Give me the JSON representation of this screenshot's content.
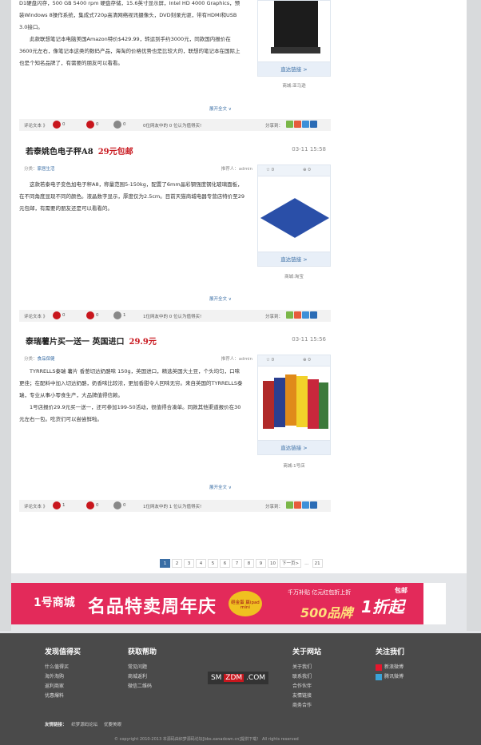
{
  "article0": {
    "body_lines": [
      "D1硬盘闪存，500 GB 5400 rpm 硬盘存储，15.6英寸显示屏，Intel HD 4000 Graphics，预装Windows 8操作系统，集成式720p高清网络视讯摄像头，DVD刻录光驱，带有HDMI和USB 3.0接口。",
      "此款联想笔记本电脑美国Amazon特价$429.99，转运到手约3000元，同款国内报价在3600元左右，像笔记本这类的数码产品，海淘的价格优势也是比较大的，联想的笔记本在国际上也是个知名品牌了，有需要的朋友可以看看。"
    ],
    "go_label": "直达链接 >",
    "mall": "商城:亚马逊",
    "expand": "展开全文 ∨",
    "footbar": {
      "comment": "评论文本 》",
      "v1": "0",
      "v2": "0",
      "v3": "0",
      "stat": "0位网友中的 0 位认为值得买!",
      "share": "分享到："
    }
  },
  "article1": {
    "title": "若泰姚色电子秤A8",
    "price": "29元包邮",
    "time": "03-11 15:58",
    "category_label": "分类：",
    "category": "家居生活",
    "recommender": "推荐人：admin",
    "fav": "☆ 0",
    "comments": "⊕ 0",
    "body_lines": [
      "这款若泰电子变色加电子秤A8，称量范围5-150kg，配置了6mm晶彩钢强度钢化玻璃面板，在不同角度显现不同的颜色。液晶数字显示，厚度仅为2.5cm。目前天猫商城电器专营店特价至29元包邮，有需要的朋友还是可以看看的。"
    ],
    "go_label": "直达链接 >",
    "mall": "商城:淘宝",
    "expand": "展开全文 ∨",
    "footbar": {
      "comment": "评论文本 》",
      "v1": "0",
      "v2": "0",
      "v3": "1",
      "stat": "1位网友中的 0 位认为值得买!",
      "share": "分享到："
    }
  },
  "article2": {
    "title": "泰瑞薯片买一送一 英国进口",
    "price": "29.9元",
    "time": "03-11 15:56",
    "category_label": "分类：",
    "category": "食品保健",
    "recommender": "推荐人：admin",
    "fav": "☆ 0",
    "comments": "⊕ 0",
    "body_lines": [
      "TYRRELLS泰瑞 薯片 香葱切达奶酪味 150g，英国进口，精选英国大土豆，个头均匀，口味更佳；在配料中加入切达奶酪，奶香味比较浓，更加香甜令人回味无穷。来自英国的TYRRELLS泰瑞，专业从事小零食生产，大品牌值得信赖。",
      "1号店报价29.9元买一送一，还可参加199-50活动，很值得合凑单。同款其他渠道报价在30元左右一包。吃货们可以尝尝鲜啦。"
    ],
    "go_label": "直达链接 >",
    "mall": "商城:1号店",
    "expand": "展开全文 ∨",
    "footbar": {
      "comment": "评论文本 》",
      "v1": "1",
      "v2": "0",
      "v3": "0",
      "stat": "1位网友中的 1 位认为值得买!",
      "share": "分享到："
    }
  },
  "pager": [
    "1",
    "2",
    "3",
    "4",
    "5",
    "6",
    "7",
    "8",
    "9",
    "10",
    "下一页>",
    "…",
    "21"
  ],
  "ad": {
    "brand": "1号商城",
    "headline": "名品特卖周年庆",
    "gift": "砸金蛋 赢ipad mini",
    "small": "千万补贴 亿元红包折上折",
    "slogan": "500品牌",
    "discount": "1折起",
    "badge": "包邮"
  },
  "footer": {
    "col1": {
      "title": "发现值得买",
      "items": [
        "什么值得买",
        "海外淘购",
        "返利商家",
        "优惠爆料"
      ]
    },
    "col2": {
      "title": "获取帮助",
      "items": [
        "常见问题",
        "商城返利",
        "微信二维码"
      ]
    },
    "col3": {
      "title": "关于网站",
      "items": [
        "关于我们",
        "联系我们",
        "合作伙伴",
        "友情链接",
        "商务合作"
      ]
    },
    "col4": {
      "title": "关注我们",
      "items": [
        "新浪微博",
        "腾讯微博"
      ]
    },
    "logo_a": "SM",
    "logo_b": "ZDM",
    "logo_c": ".COM",
    "links_label": "友情链接：",
    "links": [
      "织梦源码论坛",
      "优要美眼"
    ],
    "copyright": "© copyright 2010-2013 本源码由织梦源码论坛[bbs.xanadown.cn]提供下载！ All rights reserved"
  }
}
